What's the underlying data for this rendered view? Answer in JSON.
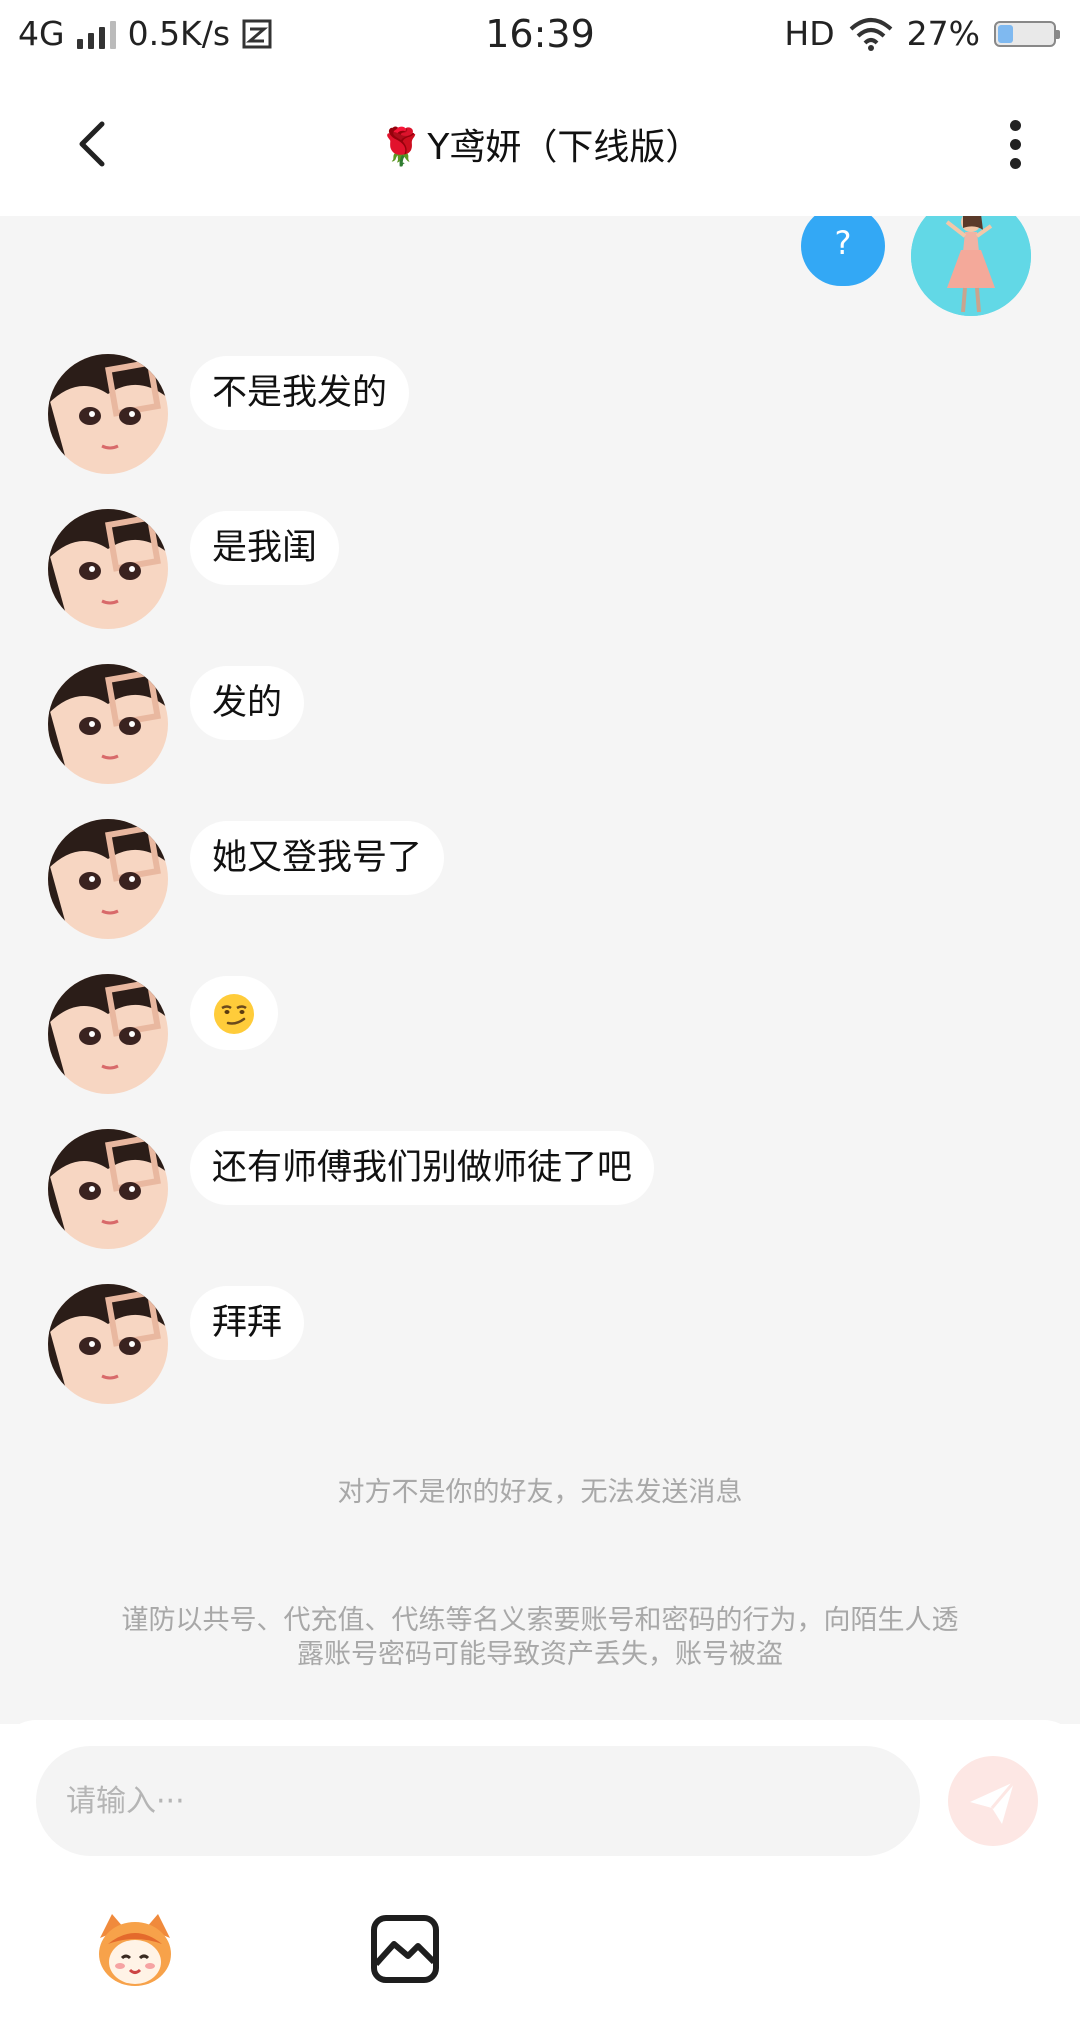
{
  "status_bar": {
    "network": "4G",
    "speed": "0.5K/s",
    "time": "16:39",
    "hd": "HD",
    "battery": "27%",
    "battery_level": 0.27
  },
  "header": {
    "title_icon": "🌹",
    "title": "Y鸢妍（下线版）"
  },
  "chat": {
    "my_message": "?",
    "messages": [
      {
        "text": "不是我发的"
      },
      {
        "text": "是我闺"
      },
      {
        "text": "发的"
      },
      {
        "text": "她又登我号了"
      },
      {
        "text": "",
        "emoji_icon": "smirk-emoji-icon"
      },
      {
        "text": "还有师傅我们别做师徒了吧"
      },
      {
        "text": "拜拜"
      }
    ],
    "system_notice": "对方不是你的好友，无法发送消息",
    "security_warning_line1": "谨防以共号、代充值、代练等名义索要账号和密码的行为，向陌生人透",
    "security_warning_line2": "露账号密码可能导致资产丢失，账号被盗"
  },
  "input": {
    "placeholder": "请输入···",
    "value": ""
  },
  "colors": {
    "accent_blue": "#33a8f5",
    "chat_background": "#f5f5f5",
    "send_button_disabled": "#fde7e4"
  }
}
